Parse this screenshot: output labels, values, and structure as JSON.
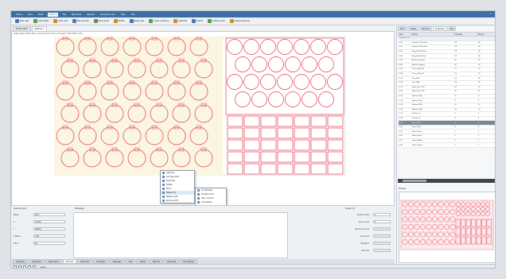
{
  "menubar": {
    "items": [
      "Home",
      "Tools",
      "Parts",
      "Nesting",
      "File",
      "Machines",
      "Reports",
      "Manufacturing",
      "Help",
      "Info"
    ],
    "active_index": 3
  },
  "toolbar": {
    "buttons": [
      "New nest",
      "Add sheets",
      "Auto nest",
      "Manual nest",
      "Move parts",
      "Rotate",
      "Reset nest",
      "Check collisions",
      "Optimize",
      "Export",
      "Cutting order",
      "Output program"
    ]
  },
  "doc_tabs": [
    "Project View",
    "Nesting 1"
  ],
  "canvas": {
    "status_line": "Sheet usage: 84.6%  Parts: 112  Cycle time: 00:41:16  Length: 3000  Width: 1500"
  },
  "context_menu": {
    "items": [
      "Optimize",
      "Arrange parts",
      "Duplicate",
      "Rotate",
      "Mirror",
      "Pattern fill",
      "Replace part",
      "Remove part"
    ],
    "highlight_index": 5,
    "submenu": [
      "Fill with Rect",
      "Fill with Circle",
      "Row / Column",
      "Grid pattern",
      "Fill Vertical",
      "Fill Horizontal",
      "Center align",
      "Keep distance"
    ]
  },
  "bottom": {
    "group_left_title": "Selected part",
    "left_fields": [
      {
        "label": "Name",
        "value": "P-12"
      },
      {
        "label": "X",
        "value": "112.00"
      },
      {
        "label": "Y",
        "value": "648.50"
      },
      {
        "label": "Rotation",
        "value": "0.00"
      },
      {
        "label": "Mirror",
        "value": "No"
      }
    ],
    "messages_title": "Messages",
    "group_right_title": "Sheet info",
    "right_fields": [
      {
        "label": "Sheet number",
        "value": "1"
      },
      {
        "label": "Sheet count",
        "value": "1"
      },
      {
        "label": "Number of parts",
        "value": ""
      },
      {
        "label": "Scrap area",
        "value": ""
      },
      {
        "label": "Utilization",
        "value": ""
      },
      {
        "label": "Remnant",
        "value": ""
      }
    ]
  },
  "bottom_tabs": [
    "Properties",
    "Operations",
    "Nest layout",
    "Parts list",
    "Sheet info",
    "Simulation",
    "Messages",
    "Cost",
    "Output",
    "Machine",
    "Remnants",
    "Tool settings"
  ],
  "bottom_tab_selected": 3,
  "statusbar": {
    "text": "Ready"
  },
  "right_panel": {
    "tabs": [
      "Parts",
      "Sheets",
      "Machines",
      "Properties",
      "Nest"
    ],
    "selected_tab": 3,
    "columns": [
      "Part",
      "Name",
      "Quantity",
      "Placed"
    ],
    "group_label": "Selection (1)",
    "rows": [
      [
        "P-01",
        "Flange_D120_Plate",
        "24",
        "24"
      ],
      [
        "P-02",
        "Flange_D120_Plate",
        "24",
        "24"
      ],
      [
        "P-03",
        "Ring_D100_Sheet",
        "18",
        "18"
      ],
      [
        "P-04",
        "Ring_D100_Sheet",
        "18",
        "18"
      ],
      [
        "P-05",
        "Bracket_Square",
        "30",
        "30"
      ],
      [
        "P-06",
        "Bracket_Square",
        "30",
        "30"
      ],
      [
        "P-07",
        "Cover_Plate_A",
        "12",
        "12"
      ],
      [
        "P-08",
        "Cover_Plate_B",
        "12",
        "12"
      ],
      [
        "P-09",
        "Disc_D80",
        "16",
        "16"
      ],
      [
        "P-10",
        "Disc_D80",
        "16",
        "16"
      ],
      [
        "P-11",
        "Plate_Rect_100",
        "20",
        "20"
      ],
      [
        "P-12",
        "Plate_Rect_100",
        "20",
        "20"
      ],
      [
        "P-13",
        "Spacer_Ring",
        "8",
        "8"
      ],
      [
        "P-14",
        "Spacer_Ring",
        "8",
        "8"
      ],
      [
        "P-15",
        "Washer_D60",
        "10",
        "10"
      ],
      [
        "P-16",
        "Washer_D60",
        "10",
        "10"
      ],
      [
        "P-17",
        "Gusset_Tri",
        "6",
        "6"
      ],
      [
        "P-18",
        "Gusset_Tri",
        "6",
        "6"
      ],
      [
        "P-19",
        "Base_Plate",
        "4",
        "4"
      ],
      [
        "P-20",
        "Base_Plate",
        "4",
        "4"
      ],
      [
        "P-21",
        "Mount_Plate",
        "2",
        "2"
      ],
      [
        "P-22",
        "Mount_Plate",
        "2",
        "2"
      ],
      [
        "P-23",
        "Shim_Square",
        "2",
        "2"
      ],
      [
        "P-24",
        "Shim_Square",
        "2",
        "2"
      ]
    ],
    "selected_row": 18,
    "preview_title": "Preview"
  },
  "colors": {
    "accent": "#3a6ea5",
    "part_outline": "#e63b4f",
    "sheet_fill": "#fbf6e2",
    "selected_row": "#7b8794"
  }
}
